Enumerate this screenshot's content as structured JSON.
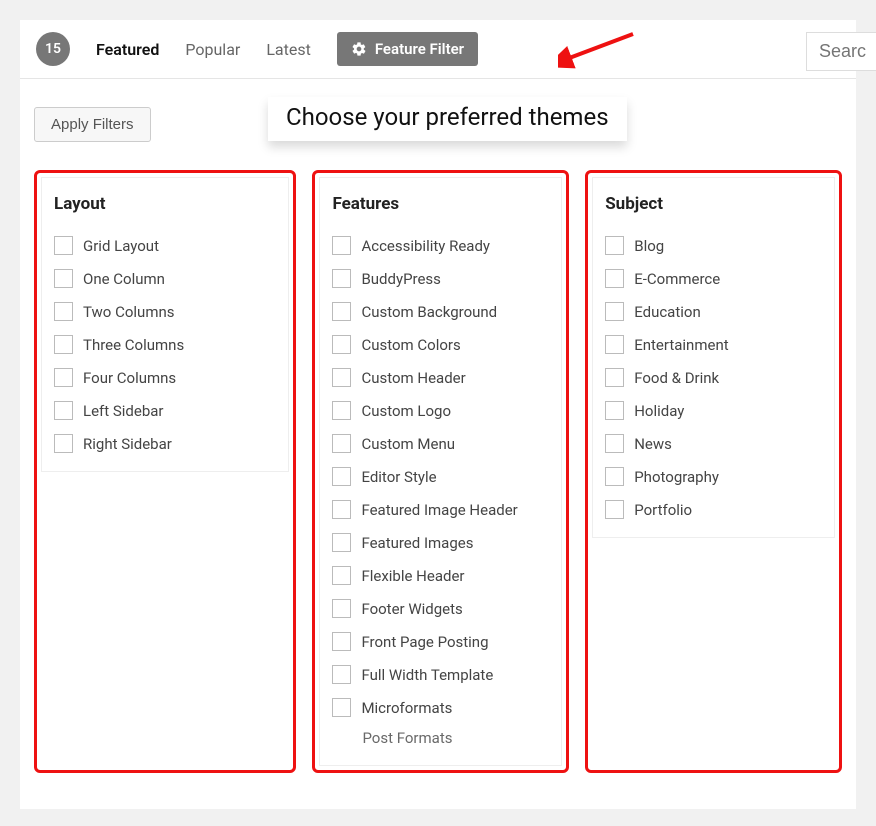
{
  "toolbar": {
    "count": "15",
    "tabs": [
      "Featured",
      "Popular",
      "Latest"
    ],
    "active_tab": 0,
    "feature_filter_label": "Feature Filter",
    "search_placeholder": "Searc"
  },
  "apply_label": "Apply Filters",
  "banner": "Choose your preferred themes",
  "columns": {
    "layout": {
      "title": "Layout",
      "items": [
        "Grid Layout",
        "One Column",
        "Two Columns",
        "Three Columns",
        "Four Columns",
        "Left Sidebar",
        "Right Sidebar"
      ]
    },
    "features": {
      "title": "Features",
      "items": [
        "Accessibility Ready",
        "BuddyPress",
        "Custom Background",
        "Custom Colors",
        "Custom Header",
        "Custom Logo",
        "Custom Menu",
        "Editor Style",
        "Featured Image Header",
        "Featured Images",
        "Flexible Header",
        "Footer Widgets",
        "Front Page Posting",
        "Full Width Template",
        "Microformats"
      ],
      "partial_next": "Post Formats"
    },
    "subject": {
      "title": "Subject",
      "items": [
        "Blog",
        "E-Commerce",
        "Education",
        "Entertainment",
        "Food & Drink",
        "Holiday",
        "News",
        "Photography",
        "Portfolio"
      ]
    }
  }
}
